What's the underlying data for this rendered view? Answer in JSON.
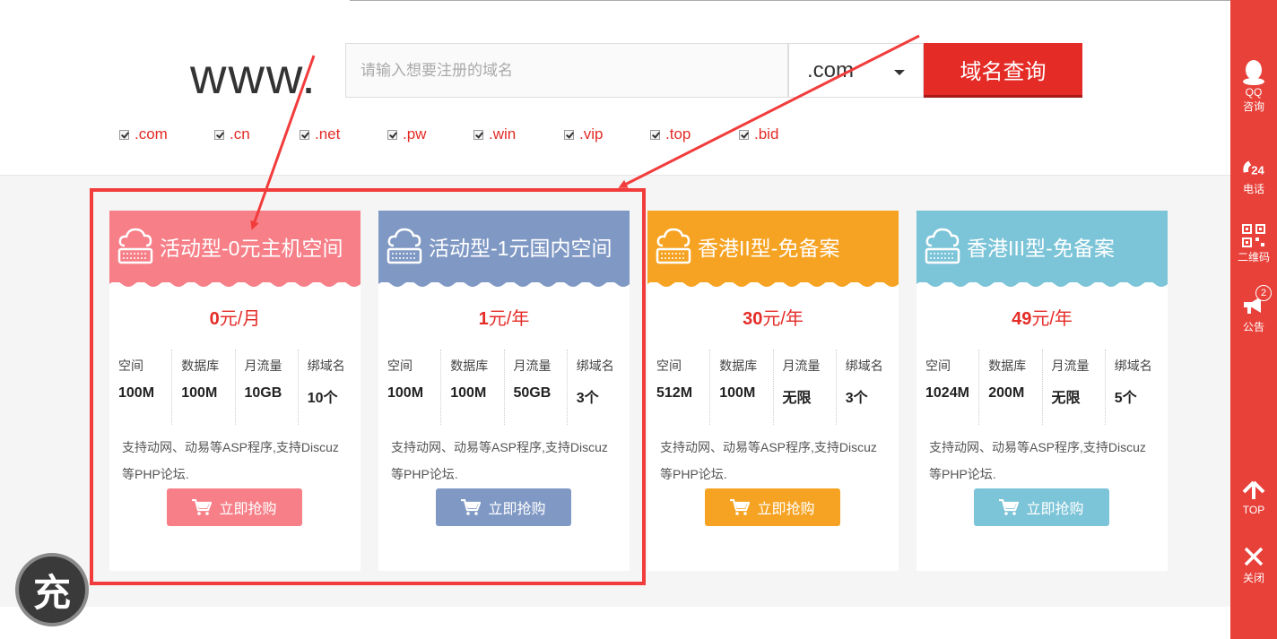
{
  "search": {
    "prefix": "www.",
    "placeholder": "请输入想要注册的域名",
    "selected_tld": ".com",
    "button_label": "域名查询"
  },
  "tld_options": [
    ".com",
    ".cn",
    ".net",
    ".pw",
    ".win",
    ".vip",
    ".top",
    ".bid"
  ],
  "cards": [
    {
      "title": "活动型-0元主机空间",
      "price_num": "0",
      "price_unit": "元/月",
      "color": "#f67f88",
      "specs": [
        {
          "label": "空间",
          "value": "100M"
        },
        {
          "label": "数据库",
          "value": "100M"
        },
        {
          "label": "月流量",
          "value": "10GB"
        },
        {
          "label": "绑域名",
          "value": "10个"
        }
      ],
      "desc": "支持动网、动易等ASP程序,支持Discuz等PHP论坛.",
      "button": "立即抢购"
    },
    {
      "title": "活动型-1元国内空间",
      "price_num": "1",
      "price_unit": "元/年",
      "color": "#8099c4",
      "specs": [
        {
          "label": "空间",
          "value": "100M"
        },
        {
          "label": "数据库",
          "value": "100M"
        },
        {
          "label": "月流量",
          "value": "50GB"
        },
        {
          "label": "绑域名",
          "value": "3个"
        }
      ],
      "desc": "支持动网、动易等ASP程序,支持Discuz等PHP论坛.",
      "button": "立即抢购"
    },
    {
      "title": "香港II型-免备案",
      "price_num": "30",
      "price_unit": "元/年",
      "color": "#f6a323",
      "specs": [
        {
          "label": "空间",
          "value": "512M"
        },
        {
          "label": "数据库",
          "value": "100M"
        },
        {
          "label": "月流量",
          "value": "无限"
        },
        {
          "label": "绑域名",
          "value": "3个"
        }
      ],
      "desc": "支持动网、动易等ASP程序,支持Discuz等PHP论坛.",
      "button": "立即抢购"
    },
    {
      "title": "香港III型-免备案",
      "price_num": "49",
      "price_unit": "元/年",
      "color": "#7cc4d8",
      "specs": [
        {
          "label": "空间",
          "value": "1024M"
        },
        {
          "label": "数据库",
          "value": "200M"
        },
        {
          "label": "月流量",
          "value": "无限"
        },
        {
          "label": "绑域名",
          "value": "5个"
        }
      ],
      "desc": "支持动网、动易等ASP程序,支持Discuz等PHP论坛.",
      "button": "立即抢购"
    }
  ],
  "sidebar": {
    "qq_line1": "QQ",
    "qq_line2": "咨询",
    "phone": "电话",
    "qrcode": "二维码",
    "notice": "公告",
    "notice_badge": "2",
    "top": "TOP",
    "close": "关闭"
  },
  "charge_label": "充",
  "colors": {
    "accent_red": "#e42b26",
    "sidebar_red": "#e8413a",
    "highlight_frame": "#f23c3c"
  }
}
